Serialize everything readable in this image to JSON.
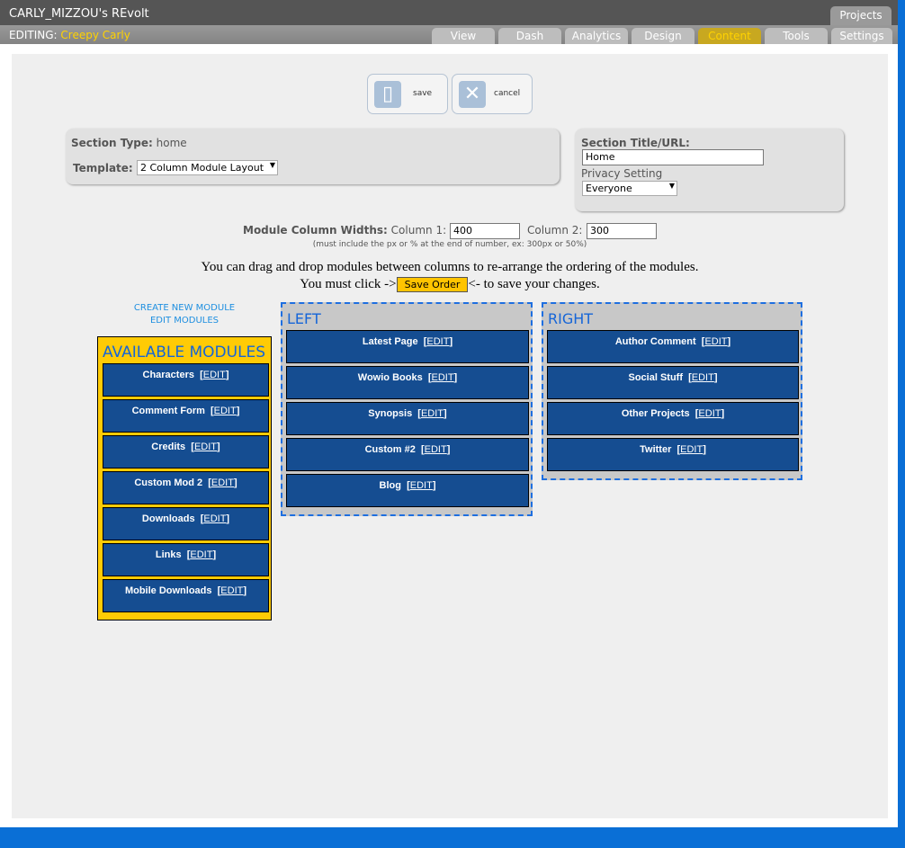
{
  "app": {
    "title": "CARLY_MIZZOU's REvolt",
    "projects": "Projects",
    "editing_label": "EDITING:",
    "editing_name": "Creepy Carly"
  },
  "tabs": [
    {
      "label": "View"
    },
    {
      "label": "Dash"
    },
    {
      "label": "Analytics"
    },
    {
      "label": "Design"
    },
    {
      "label": "Content"
    },
    {
      "label": "Tools"
    },
    {
      "label": "Settings"
    }
  ],
  "toolbar": {
    "save": "save",
    "cancel": "cancel"
  },
  "section": {
    "type_label": "Section Type:",
    "type_value": "home",
    "template_label": "Template:",
    "template_value": "2 Column Module Layout",
    "title_label": "Section Title/URL:",
    "title_value": "Home",
    "privacy_label": "Privacy Setting",
    "privacy_value": "Everyone"
  },
  "widths": {
    "label": "Module Column Widths:",
    "col1_label": "Column 1:",
    "col1": "400",
    "col2_label": "Column 2:",
    "col2": "300",
    "hint": "(must include the px or % at the end of number, ex: 300px or 50%)"
  },
  "instructions": {
    "line1": "You can drag and drop modules between columns to re-arrange the ordering of the modules.",
    "pre": "You must click ->",
    "button": "Save Order",
    "post": "<- to save your changes."
  },
  "links": {
    "create": "CREATE NEW MODULE",
    "edit": "EDIT MODULES"
  },
  "edit_label": "EDIT",
  "available": {
    "title": "AVAILABLE MODULES",
    "items": [
      "Characters",
      "Comment Form",
      "Credits",
      "Custom Mod 2",
      "Downloads",
      "Links",
      "Mobile Downloads"
    ]
  },
  "left": {
    "title": "LEFT",
    "items": [
      "Latest Page",
      "Wowio Books",
      "Synopsis",
      "Custom #2",
      "Blog"
    ]
  },
  "right": {
    "title": "RIGHT",
    "items": [
      "Author Comment",
      "Social Stuff",
      "Other Projects",
      "Twitter"
    ]
  }
}
